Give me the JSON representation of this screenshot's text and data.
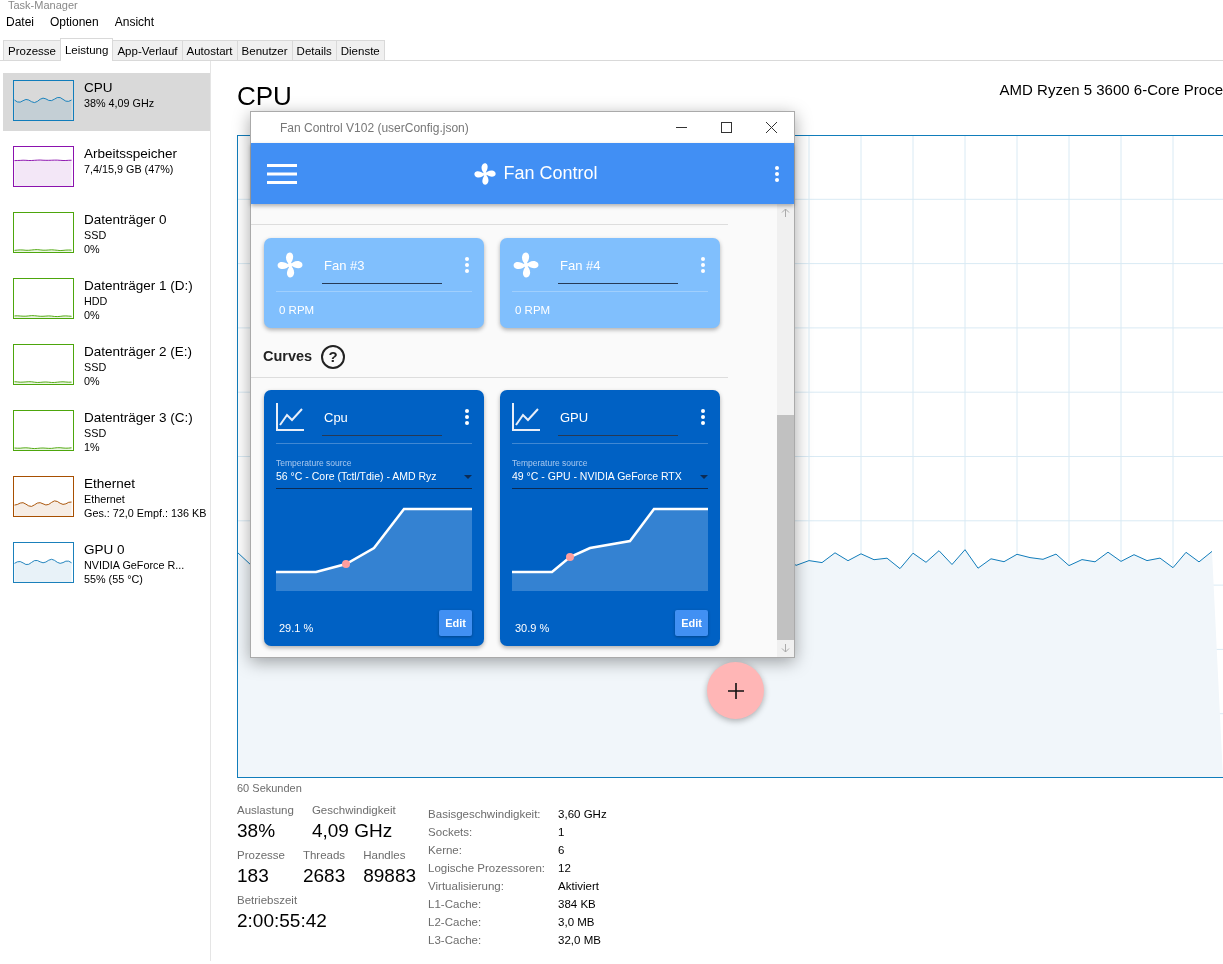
{
  "window": {
    "title": "Task-Manager"
  },
  "menu": [
    "Datei",
    "Optionen",
    "Ansicht"
  ],
  "tabs": [
    {
      "label": "Prozesse",
      "selected": false
    },
    {
      "label": "Leistung",
      "selected": true
    },
    {
      "label": "App-Verlauf",
      "selected": false
    },
    {
      "label": "Autostart",
      "selected": false
    },
    {
      "label": "Benutzer",
      "selected": false
    },
    {
      "label": "Details",
      "selected": false
    },
    {
      "label": "Dienste",
      "selected": false
    }
  ],
  "sidebar": {
    "items": [
      {
        "name": "CPU",
        "lines": [
          "38%  4,09 GHz"
        ],
        "selected": true,
        "color": "#117dbb"
      },
      {
        "name": "Arbeitsspeicher",
        "lines": [
          "7,4/15,9 GB (47%)"
        ],
        "selected": false,
        "color": "#8b12ae"
      },
      {
        "name": "Datenträger 0",
        "lines": [
          "SSD",
          "0%"
        ],
        "selected": false,
        "color": "#4da60c"
      },
      {
        "name": "Datenträger 1 (D:)",
        "lines": [
          "HDD",
          "0%"
        ],
        "selected": false,
        "color": "#4da60c"
      },
      {
        "name": "Datenträger 2 (E:)",
        "lines": [
          "SSD",
          "0%"
        ],
        "selected": false,
        "color": "#4da60c"
      },
      {
        "name": "Datenträger 3 (C:)",
        "lines": [
          "SSD",
          "1%"
        ],
        "selected": false,
        "color": "#4da60c"
      },
      {
        "name": "Ethernet",
        "lines": [
          "Ethernet",
          "Ges.: 72,0 Empf.: 136 KB"
        ],
        "selected": false,
        "color": "#a74f01"
      },
      {
        "name": "GPU 0",
        "lines": [
          "NVIDIA GeForce R...",
          "55% (55 °C)"
        ],
        "selected": false,
        "color": "#1a80bb"
      }
    ]
  },
  "detail": {
    "title": "CPU",
    "processor": "AMD Ryzen 5 3600 6-Core Proce",
    "time_label": "60 Sekunden",
    "stat_rows": [
      [
        {
          "label": "Auslastung",
          "value": "38%"
        },
        {
          "label": "Geschwindigkeit",
          "value": "4,09 GHz"
        }
      ],
      [
        {
          "label": "Prozesse",
          "value": "183"
        },
        {
          "label": "Threads",
          "value": "2683"
        },
        {
          "label": "Handles",
          "value": "89883"
        }
      ],
      [
        {
          "label": "Betriebszeit",
          "value": "2:00:55:42"
        }
      ]
    ],
    "specs": [
      {
        "label": "Basisgeschwindigkeit:",
        "value": "3,60 GHz"
      },
      {
        "label": "Sockets:",
        "value": "1"
      },
      {
        "label": "Kerne:",
        "value": "6"
      },
      {
        "label": "Logische Prozessoren:",
        "value": "12"
      },
      {
        "label": "Virtualisierung:",
        "value": "Aktiviert"
      },
      {
        "label": "L1-Cache:",
        "value": "384 KB"
      },
      {
        "label": "L2-Cache:",
        "value": "3,0 MB"
      },
      {
        "label": "L3-Cache:",
        "value": "32,0 MB"
      }
    ]
  },
  "fan_control": {
    "window_title": "Fan Control V102 (userConfig.json)",
    "app_title": "Fan Control",
    "speeds": [
      {
        "name": "Fan #3",
        "reading": "0 RPM"
      },
      {
        "name": "Fan #4",
        "reading": "0 RPM"
      }
    ],
    "curves_heading": "Curves",
    "help_glyph": "?",
    "curves": [
      {
        "name": "Cpu",
        "source_label": "Temperature source",
        "source": "56 °C - Core (Tctl/Tdie) - AMD Ryz",
        "output": "29.1 %",
        "button": "Edit"
      },
      {
        "name": "GPU",
        "source_label": "Temperature source",
        "source": "49 °C - GPU - NVIDIA GeForce RTX",
        "output": "30.9 %",
        "button": "Edit"
      }
    ]
  }
}
